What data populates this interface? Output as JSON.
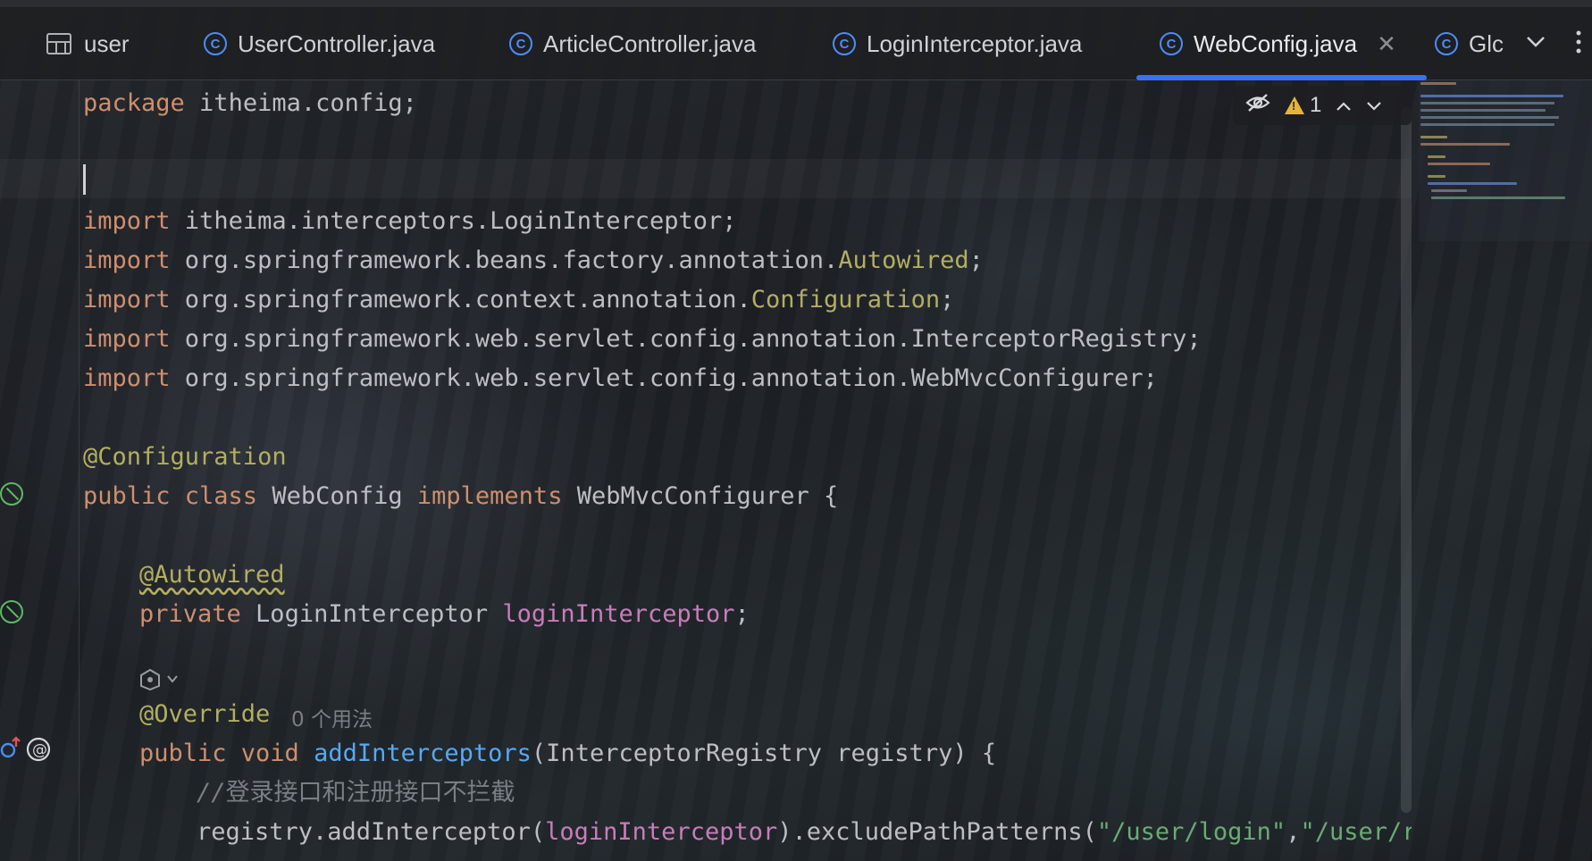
{
  "tabs": [
    {
      "label": "user",
      "icon": "table-icon",
      "active": false
    },
    {
      "label": "UserController.java",
      "icon": "class-icon",
      "active": false
    },
    {
      "label": "ArticleController.java",
      "icon": "class-icon",
      "active": false
    },
    {
      "label": "LoginInterceptor.java",
      "icon": "class-icon",
      "active": false
    },
    {
      "label": "WebConfig.java",
      "icon": "class-icon",
      "active": true
    },
    {
      "label": "Glc",
      "icon": "class-icon",
      "active": false
    }
  ],
  "class_icon_glyph": "C",
  "tab_close_glyph": "✕",
  "inspection": {
    "warnings": "1",
    "hide_icon": "eye-crossed-icon"
  },
  "code": {
    "package": {
      "kw": "package",
      "name": " itheima.config;"
    },
    "import1": {
      "kw": "import",
      "rest": " itheima.interceptors.LoginInterceptor;"
    },
    "import2": {
      "kw": "import",
      "rest": " org.springframework.beans.factory.annotation.",
      "ann": "Autowired",
      "end": ";"
    },
    "import3": {
      "kw": "import",
      "rest": " org.springframework.context.annotation.",
      "ann": "Configuration",
      "end": ";"
    },
    "import4": {
      "kw": "import",
      "rest": " org.springframework.web.servlet.config.annotation.InterceptorRegistry;"
    },
    "import5": {
      "kw": "import",
      "rest": " org.springframework.web.servlet.config.annotation.WebMvcConfigurer;"
    },
    "config_ann": "@Configuration",
    "class_decl": {
      "kw1": "public class",
      "name": " WebConfig ",
      "kw2": "implements",
      "rest": " WebMvcConfigurer {"
    },
    "autowired_ann": "@Autowired",
    "field": {
      "kw": "private",
      "type": " LoginInterceptor ",
      "name": "loginInterceptor",
      "end": ";"
    },
    "override_ann": "@Override",
    "usages_hint": "0 个用法",
    "method": {
      "kw": "public void",
      "name": "addInterceptors",
      "rest": "(InterceptorRegistry registry) {"
    },
    "comment": {
      "slashes": "//",
      "text": "登录接口和注册接口不拦截"
    },
    "registry_line": {
      "start": "registry.addInterceptor(",
      "field": "loginInterceptor",
      "mid": ").excludePathPatterns(",
      "s1": "\"/user/login\"",
      "comma": ",",
      "s2": "\"/user/reg"
    }
  },
  "colors": {
    "accent": "#3574f0",
    "keyword": "#cf8e6d",
    "annotation": "#b3ae60",
    "field": "#c77dbb",
    "function": "#56a8f5",
    "string": "#6aab73",
    "comment": "#7a7e85"
  }
}
